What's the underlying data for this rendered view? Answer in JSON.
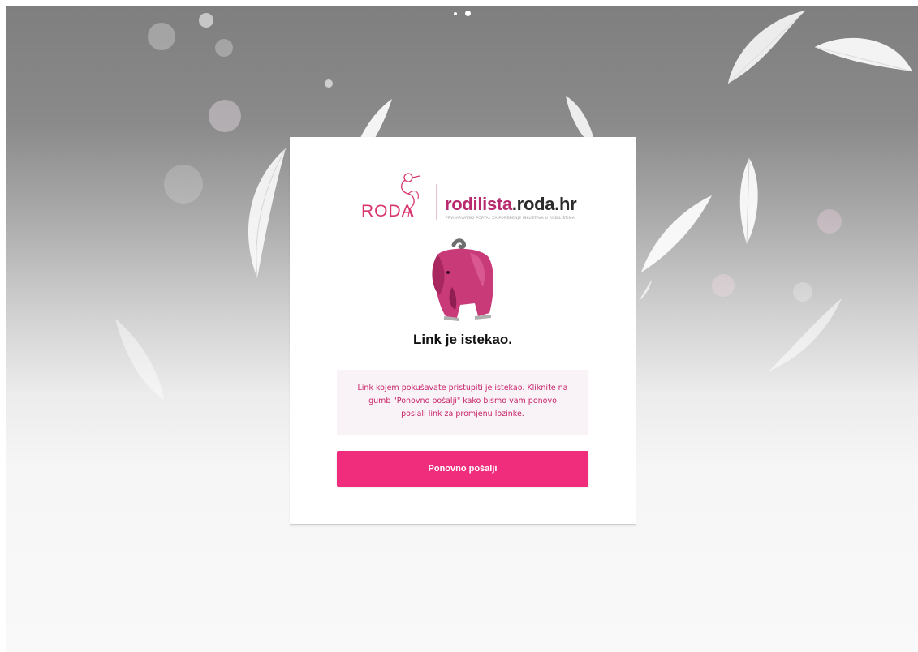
{
  "brand": {
    "roda_logo_text": "RODA",
    "site_name_pink": "rodilista",
    "site_name_dark": ".roda.hr",
    "tagline": "PRVI HRVATSKI PORTAL ZA POREĐENJE ISKUSTAVA U RODILIŠTIMA",
    "color_pink": "#ef2d7c",
    "color_magenta": "#b8296d"
  },
  "status": {
    "title": "Link je istekao.",
    "message": "Link kojem pokušavate pristupiti je istekao. Kliknite na gumb \"Ponovno pošalji\" kako bismo vam ponovo poslali link za promjenu lozinke."
  },
  "actions": {
    "resend_label": "Ponovno pošalji"
  },
  "carousel": {
    "slide_count": 2,
    "active_index": 2
  }
}
